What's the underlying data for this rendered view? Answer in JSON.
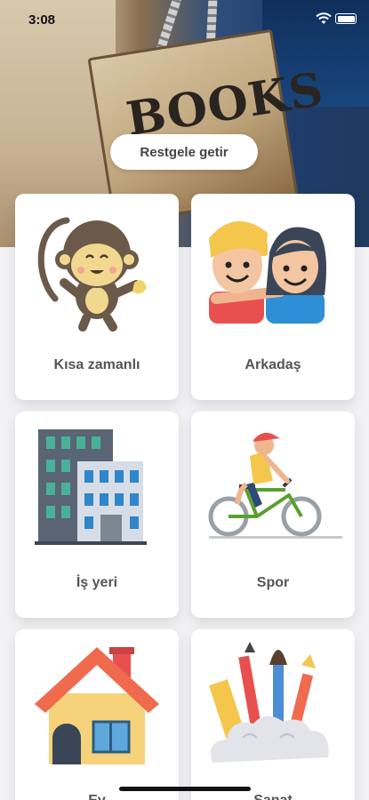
{
  "status_bar": {
    "time": "3:08"
  },
  "hero": {
    "sign_text": "BOOKS",
    "random_button_label": "Restgele getir"
  },
  "categories": [
    {
      "label": "Kısa zamanlı",
      "icon": "monkey-icon"
    },
    {
      "label": "Arkadaş",
      "icon": "friends-icon"
    },
    {
      "label": "İş yeri",
      "icon": "office-building-icon"
    },
    {
      "label": "Spor",
      "icon": "cyclist-icon"
    },
    {
      "label": "Ev",
      "icon": "house-icon"
    },
    {
      "label": "Sanat",
      "icon": "art-supplies-icon"
    }
  ],
  "colors": {
    "card_bg": "#ffffff",
    "label": "#555555",
    "page_bg": "#f2f2f4"
  }
}
